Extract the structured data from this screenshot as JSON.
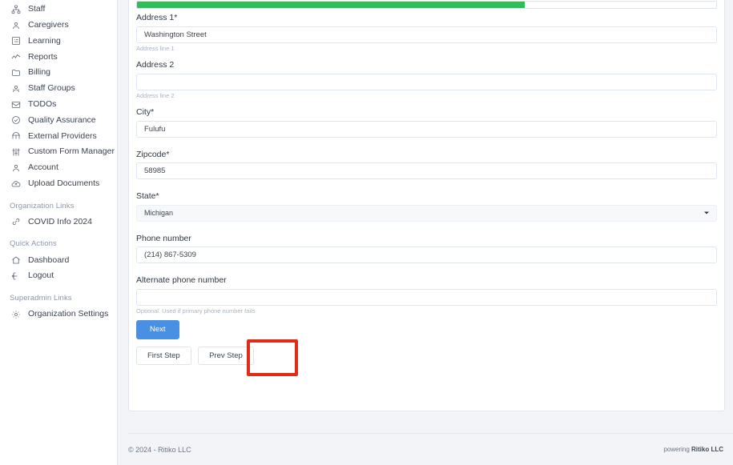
{
  "sidebar": {
    "items": [
      {
        "label": "Staff",
        "icon": "org-chart-icon",
        "name": "sidebar-item-staff"
      },
      {
        "label": "Caregivers",
        "icon": "user-icon",
        "name": "sidebar-item-caregivers"
      },
      {
        "label": "Learning",
        "icon": "book-grid-icon",
        "name": "sidebar-item-learning"
      },
      {
        "label": "Reports",
        "icon": "line-chart-icon",
        "name": "sidebar-item-reports"
      },
      {
        "label": "Billing",
        "icon": "folder-icon",
        "name": "sidebar-item-billing"
      },
      {
        "label": "Staff Groups",
        "icon": "users-group-icon",
        "name": "sidebar-item-staff-groups"
      },
      {
        "label": "TODOs",
        "icon": "envelope-icon",
        "name": "sidebar-item-todos"
      },
      {
        "label": "Quality Assurance",
        "icon": "check-circle-icon",
        "name": "sidebar-item-quality-assurance"
      },
      {
        "label": "External Providers",
        "icon": "bridge-icon",
        "name": "sidebar-item-external-providers"
      },
      {
        "label": "Custom Form Manager",
        "icon": "sliders-icon",
        "name": "sidebar-item-custom-form-manager"
      },
      {
        "label": "Account",
        "icon": "user-icon",
        "name": "sidebar-item-account"
      },
      {
        "label": "Upload Documents",
        "icon": "cloud-upload-icon",
        "name": "sidebar-item-upload-documents"
      }
    ],
    "sections": [
      {
        "title": "Organization Links",
        "items": [
          {
            "label": "COVID Info 2024",
            "icon": "link-icon",
            "name": "sidebar-item-covid-info-2024"
          }
        ]
      },
      {
        "title": "Quick Actions",
        "items": [
          {
            "label": "Dashboard",
            "icon": "home-icon",
            "name": "sidebar-item-dashboard"
          },
          {
            "label": "Logout",
            "icon": "logout-icon",
            "name": "sidebar-item-logout"
          }
        ]
      },
      {
        "title": "Superadmin Links",
        "items": [
          {
            "label": "Organization Settings",
            "icon": "gear-icon",
            "name": "sidebar-item-organization-settings"
          }
        ]
      }
    ]
  },
  "form": {
    "progress": {
      "percent": 67,
      "fill_color": "#2ebd59"
    },
    "address1": {
      "label": "Address 1*",
      "value": "Washington Street",
      "placeholder": "",
      "help": "Address line 1"
    },
    "address2": {
      "label": "Address 2",
      "value": "",
      "placeholder": "",
      "help": "Address line 2"
    },
    "city": {
      "label": "City*",
      "value": "Fulufu",
      "placeholder": "",
      "help": ""
    },
    "zipcode": {
      "label": "Zipcode*",
      "value": "58985",
      "placeholder": "",
      "help": ""
    },
    "state": {
      "label": "State*",
      "value": "Michigan",
      "help": ""
    },
    "phone": {
      "label": "Phone number",
      "value": "(214) 867-5309",
      "placeholder": "",
      "help": ""
    },
    "alt_phone": {
      "label": "Alternate phone number",
      "value": "",
      "placeholder": "",
      "help": "Optional. Used if primary phone number fails"
    },
    "buttons": {
      "next": "Next",
      "first_step": "First Step",
      "prev_step": "Prev Step"
    }
  },
  "highlight": {
    "color": "#e02b16"
  },
  "footer": {
    "copyright": "© 2024 - Ritiko LLC",
    "powering_prefix": "powering ",
    "powering_brand": "Ritiko LLC"
  }
}
